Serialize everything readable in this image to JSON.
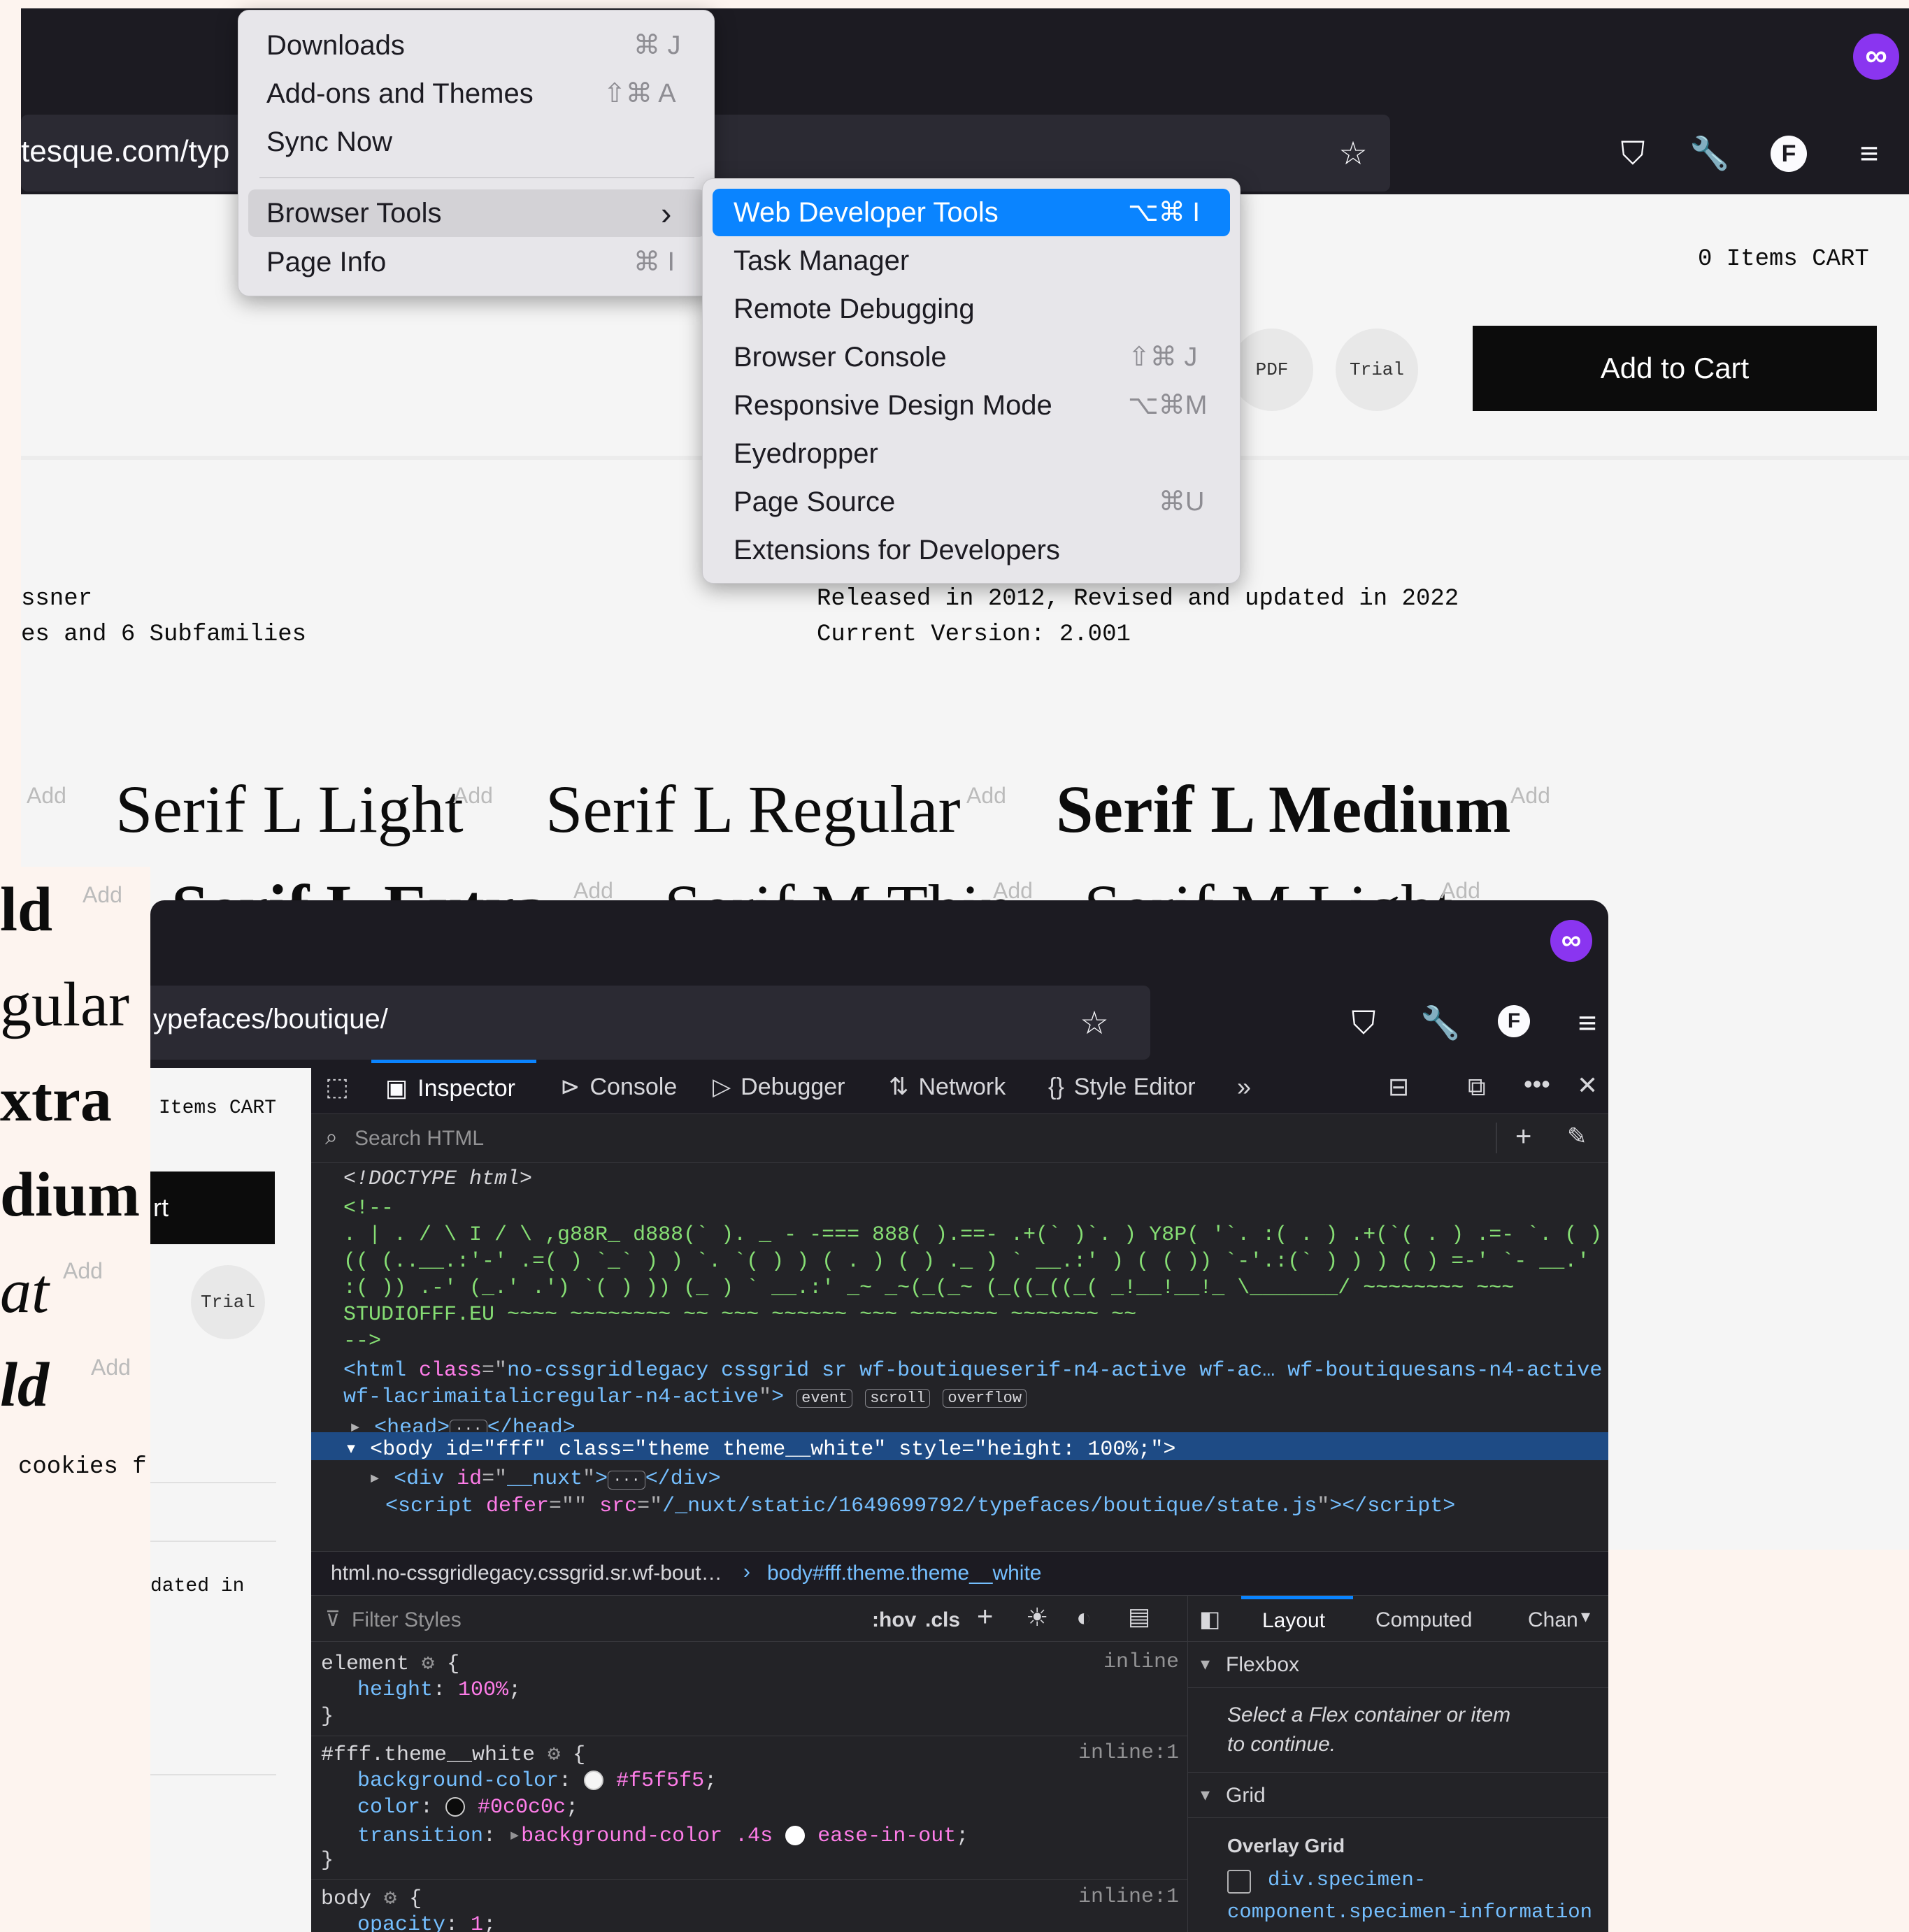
{
  "main_browser": {
    "url_fragment": "tesque.com/typ",
    "cart_text": "0 Items CART",
    "pdf_label": "PDF",
    "trial_label": "Trial",
    "add_to_cart": "Add to Cart",
    "info": {
      "left_line1": "ssner",
      "left_line2": "es and 6 Subfamilies",
      "right_line1": "Released in 2012, Revised and updated in 2022",
      "right_line2": "Current Version: 2.001"
    },
    "specimens_row1": [
      "Serif L Light",
      "Serif L Regular",
      "Serif L Medium"
    ],
    "specimens_row2": [
      "Serif L Extra",
      "Serif M Thin",
      "Serif M Light"
    ],
    "add_label": "Add"
  },
  "app_menu": {
    "items": [
      {
        "label": "Downloads",
        "shortcut": "⌘ J"
      },
      {
        "label": "Add-ons and Themes",
        "shortcut": "⇧⌘ A"
      },
      {
        "label": "Sync Now",
        "shortcut": ""
      },
      {
        "label": "Browser Tools",
        "shortcut": "›"
      },
      {
        "label": "Page Info",
        "shortcut": "⌘ I"
      }
    ]
  },
  "browser_tools_menu": {
    "items": [
      {
        "label": "Web Developer Tools",
        "shortcut": "⌥⌘ I"
      },
      {
        "label": "Task Manager",
        "shortcut": ""
      },
      {
        "label": "Remote Debugging",
        "shortcut": ""
      },
      {
        "label": "Browser Console",
        "shortcut": "⇧⌘ J"
      },
      {
        "label": "Responsive Design Mode",
        "shortcut": "⌥⌘M"
      },
      {
        "label": "Eyedropper",
        "shortcut": ""
      },
      {
        "label": "Page Source",
        "shortcut": "⌘U"
      },
      {
        "label": "Extensions for Developers",
        "shortcut": ""
      }
    ]
  },
  "left_page": {
    "words": [
      "ld",
      "gular",
      "xtra",
      "dium",
      "at",
      "ld"
    ],
    "cookies": "cookies f",
    "dated": "dated in"
  },
  "win2": {
    "url_fragment": "ypefaces/boutique/",
    "cart_text": "Items CART",
    "button_fragment": "rt",
    "trial_label": "Trial"
  },
  "devtools": {
    "tabs": [
      "Inspector",
      "Console",
      "Debugger",
      "Network",
      "Style Editor"
    ],
    "search_placeholder": "Search HTML",
    "markup": {
      "doctype": "<!DOCTYPE html>",
      "comment_open": "<!--",
      "ascii1": ". | . / \\ I / \\ ,g88R_ d888(` ). _ - -=== 888( ).==- .+(` )`. ) Y8P( '`. :( . ) .+(`( . ) .=- `. ( ) )",
      "ascii2": "(( (..__.:'-' .=( ) `_` ) ) `. `( ) ) ( . ) ( ) ._ ) ` __.:' ) ( ( )) `-'.:(` ) ) ) ( ) =-' `- __.'",
      "ascii3": ":( )) .-' (_.' .') `( ) )) (_ ) ` __.:' _~ _~(_(_~ (_((_((_( _!__!__!_ \\_______/ ~~~~~~~~ ~~~",
      "ascii4": "STUDIOFFF.EU ~~~~ ~~~~~~~~ ~~ ~~~ ~~~~~~ ~~~ ~~~~~~~ ~~~~~~~ ~~",
      "comment_close": "-->",
      "html_class_1": "no-cssgridlegacy cssgrid sr wf-boutiqueserif-n4-active wf-ac… wf-boutiquesans-n4-active",
      "html_class_2": "wf-lacrimaitalicregular-n4-active",
      "badges": [
        "event",
        "scroll",
        "overflow"
      ],
      "body_id": "fff",
      "body_class": "theme theme__white",
      "body_style": "height: 100%;",
      "div_id": "__nuxt",
      "script_src": "/_nuxt/static/1649699792/typefaces/boutique/state.js"
    },
    "breadcrumb_1": "html.no-cssgridlegacy.cssgrid.sr.wf-bout…",
    "breadcrumb_2": "body#fff.theme.theme__white",
    "filter_placeholder": "Filter Styles",
    "hov": ":hov",
    "cls": ".cls",
    "rules": {
      "element_selector": "element",
      "element_source": "inline",
      "element_prop": "height",
      "element_val": "100%",
      "theme_selector": "#fff.theme__white",
      "theme_source": "inline:1",
      "bg_prop": "background-color",
      "bg_val": "#f5f5f5",
      "color_prop": "color",
      "color_val": "#0c0c0c",
      "transition_prop": "transition",
      "transition_val1": "background-color .4s",
      "transition_val2": "ease-in-out",
      "body_selector": "body",
      "body_source": "inline:1",
      "opacity_prop": "opacity",
      "opacity_val": "1"
    },
    "side_tabs": [
      "Layout",
      "Computed",
      "Chan"
    ],
    "flexbox_title": "Flexbox",
    "flexbox_msg1": "Select a Flex container or item",
    "flexbox_msg2": "to continue.",
    "grid_title": "Grid",
    "overlay_grid": "Overlay Grid",
    "grid_item_1": "div.specimen-",
    "grid_item_2": "component.specimen-information"
  },
  "colors": {
    "accent": "#0a84ff",
    "extension": "#8a35f0",
    "selected_row": "#1e4b85"
  }
}
